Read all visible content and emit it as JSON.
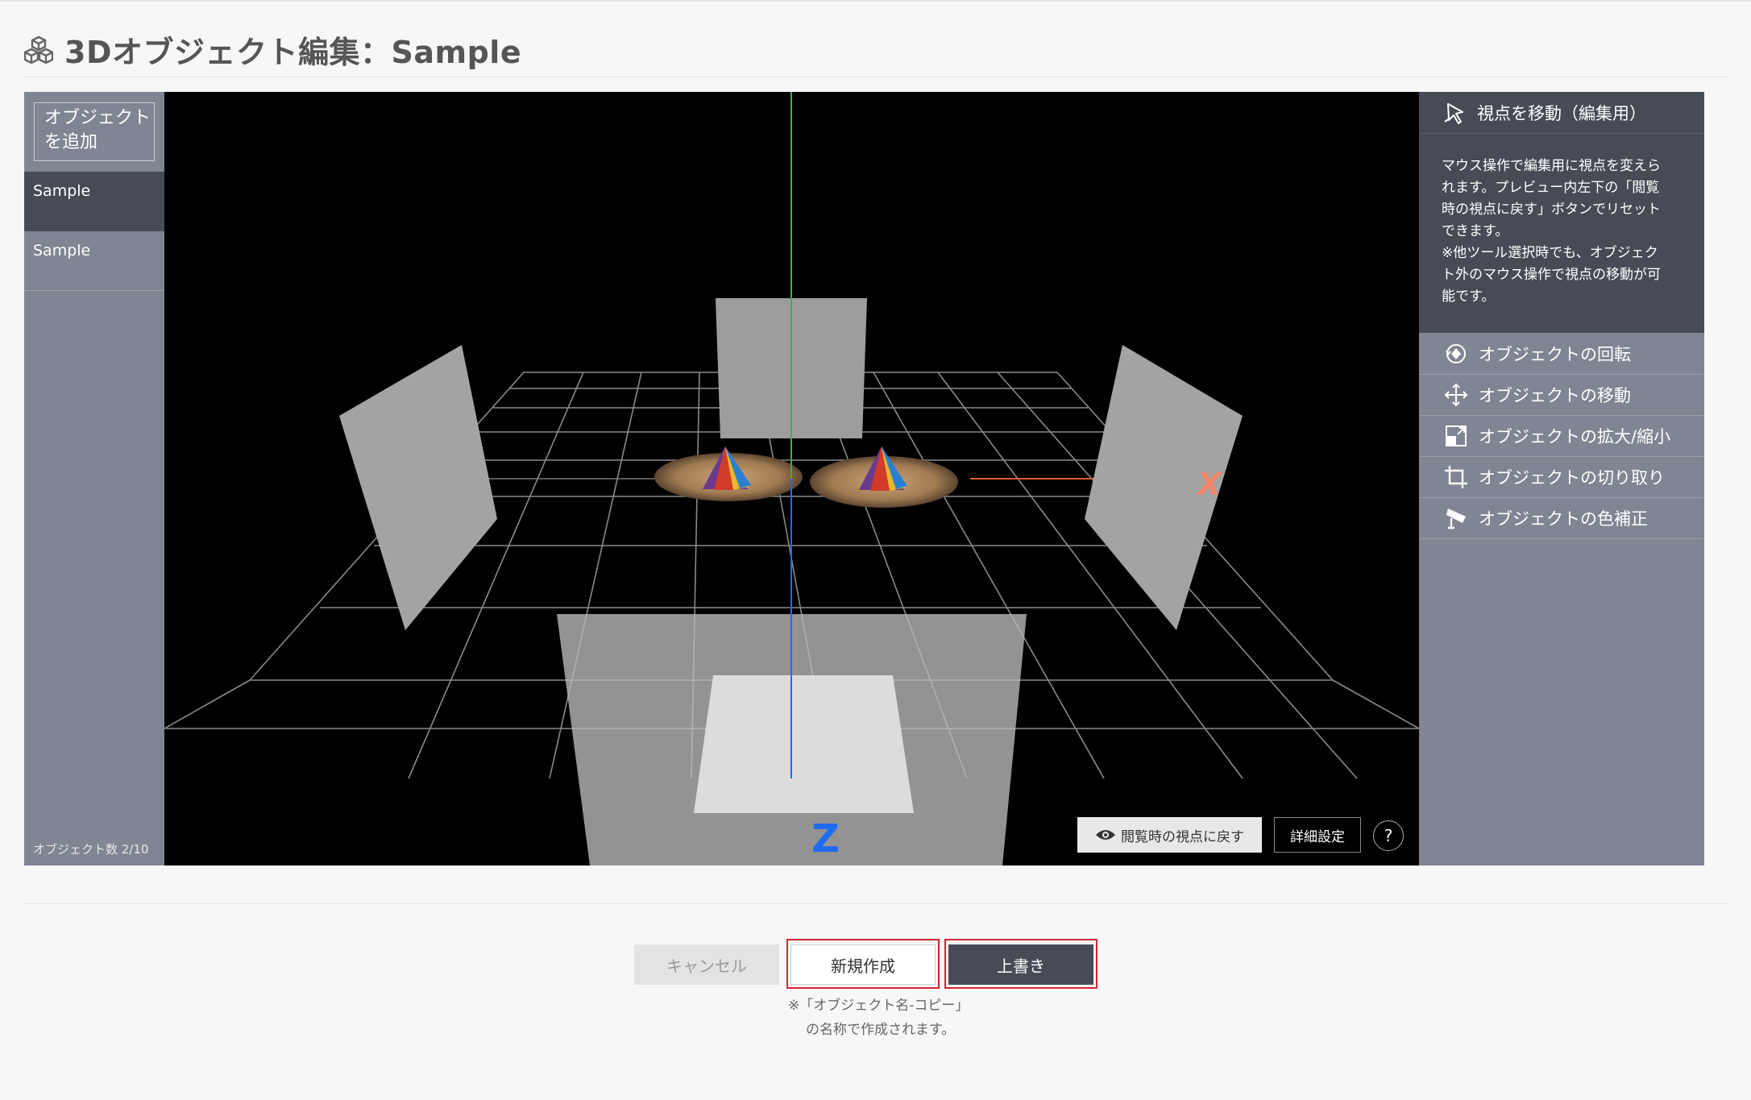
{
  "page": {
    "title": "3Dオブジェクト編集：Sample"
  },
  "object_panel": {
    "add_button": [
      "オブジェクト",
      "を追加"
    ],
    "items": [
      {
        "label": "Sample",
        "active": true
      },
      {
        "label": "Sample",
        "active": false
      }
    ],
    "count": "オブジェクト数 2/10"
  },
  "viewport": {
    "axis_labels": {
      "x": "X",
      "z": "Z"
    },
    "reset_view_button": "閲覧時の視点に戻す",
    "detail_button": "詳細設定",
    "help_button": "?"
  },
  "tools": {
    "active": {
      "label": "視点を移動（編集用）",
      "icon": "cursor-icon"
    },
    "description": [
      "マウス操作で編集用に視点を変えら",
      "れます。プレビュー内左下の「閲覧",
      "時の視点に戻す」ボタンでリセット",
      "できます。",
      "※他ツール選択時でも、オブジェク",
      "ト外のマウス操作で視点の移動が可",
      "能です。"
    ],
    "items": [
      {
        "label": "オブジェクトの回転",
        "icon": "rotate-icon"
      },
      {
        "label": "オブジェクトの移動",
        "icon": "move-icon"
      },
      {
        "label": "オブジェクトの拡大/縮小",
        "icon": "scale-icon"
      },
      {
        "label": "オブジェクトの切り取り",
        "icon": "crop-icon"
      },
      {
        "label": "オブジェクトの色補正",
        "icon": "color-correct-icon"
      }
    ]
  },
  "footer": {
    "cancel_button": "キャンセル",
    "new_button": "新規作成",
    "overwrite_button": "上書き",
    "note": [
      "※「オブジェクト名-コピー」",
      "の名称で作成されます。"
    ]
  },
  "colors": {
    "panel_dark": "#464b56",
    "panel": "#7f8592",
    "highlight": "#d9232e",
    "x_axis": "#e05a2b",
    "y_axis": "#3bb43b",
    "z_axis": "#1e6bf0"
  }
}
